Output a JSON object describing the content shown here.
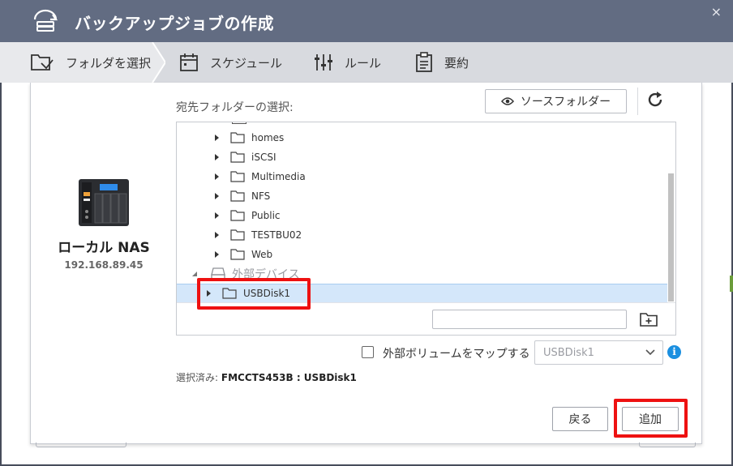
{
  "window": {
    "title": "バックアップジョブの作成",
    "close_label": "×"
  },
  "steps": [
    {
      "label": "フォルダを選択",
      "active": true
    },
    {
      "label": "スケジュール",
      "active": false
    },
    {
      "label": "ルール",
      "active": false
    },
    {
      "label": "要約",
      "active": false
    }
  ],
  "nas": {
    "name": "ローカル NAS",
    "ip": "192.168.89.45"
  },
  "folder_panel": {
    "dest_label": "宛先フォルダーの選択:",
    "source_button": "ソースフォルダー",
    "tree": {
      "folders": [
        "homes",
        "iSCSI",
        "Multimedia",
        "NFS",
        "Public",
        "TESTBU02",
        "Web"
      ],
      "external_group": "外部デバイス",
      "selected_item": "USBDisk1"
    },
    "new_folder_value": ""
  },
  "map_volume": {
    "label": "外部ボリュームをマップする",
    "checked": false,
    "select_value": "USBDisk1"
  },
  "selection": {
    "prefix": "選択済み:",
    "value": "FMCCTS453B : USBDisk1"
  },
  "buttons": {
    "back": "戻る",
    "add": "追加"
  },
  "colors": {
    "title_bar": "#626c82",
    "steps_bar": "#d8dadf",
    "selection": "#d4e7fa",
    "highlight": "#ee1111",
    "info": "#1a8fe0"
  }
}
